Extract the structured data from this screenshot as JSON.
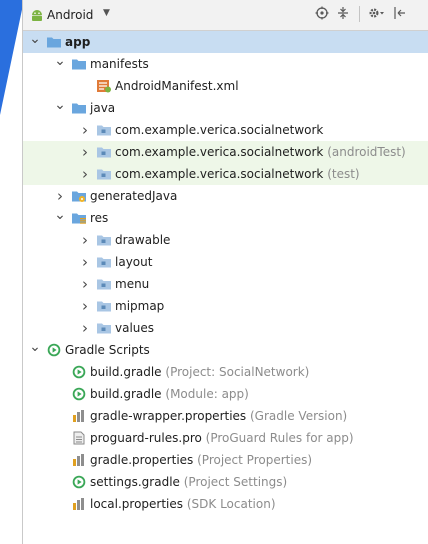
{
  "toolbar": {
    "view_label": "Android",
    "caret": "▼",
    "icons": [
      "target-icon",
      "collapse-icon",
      "gear-icon",
      "hide-icon"
    ]
  },
  "colors": {
    "selection": "#c8ddf2",
    "test_row": "#eef7e8",
    "folder_blue": "#6aa6de",
    "gradle_green": "#3aa757",
    "note_gray": "#8c8c8c",
    "deco_blue": "#2a6fde"
  },
  "tree": [
    {
      "id": "app",
      "depth": 0,
      "arrow": "expanded",
      "icon": "folder",
      "label": "app",
      "bold": true,
      "selected": true
    },
    {
      "id": "manifests",
      "depth": 1,
      "arrow": "expanded",
      "icon": "folder",
      "label": "manifests"
    },
    {
      "id": "androidmanifest",
      "depth": 2,
      "arrow": "none",
      "icon": "manifest",
      "label": "AndroidManifest.xml"
    },
    {
      "id": "java",
      "depth": 1,
      "arrow": "expanded",
      "icon": "folder",
      "label": "java"
    },
    {
      "id": "pkg-main",
      "depth": 2,
      "arrow": "collapsed",
      "icon": "package",
      "label": "com.example.verica.socialnetwork"
    },
    {
      "id": "pkg-androidtest",
      "depth": 2,
      "arrow": "collapsed",
      "icon": "package",
      "label": "com.example.verica.socialnetwork",
      "note": "(androidTest)",
      "test": true
    },
    {
      "id": "pkg-test",
      "depth": 2,
      "arrow": "collapsed",
      "icon": "package",
      "label": "com.example.verica.socialnetwork",
      "note": "(test)",
      "test": true
    },
    {
      "id": "generatedjava",
      "depth": 1,
      "arrow": "collapsed",
      "icon": "folder-generated",
      "label": "generatedJava"
    },
    {
      "id": "res",
      "depth": 1,
      "arrow": "expanded",
      "icon": "folder-res",
      "label": "res"
    },
    {
      "id": "drawable",
      "depth": 2,
      "arrow": "collapsed",
      "icon": "package",
      "label": "drawable"
    },
    {
      "id": "layout",
      "depth": 2,
      "arrow": "collapsed",
      "icon": "package",
      "label": "layout"
    },
    {
      "id": "menu",
      "depth": 2,
      "arrow": "collapsed",
      "icon": "package",
      "label": "menu"
    },
    {
      "id": "mipmap",
      "depth": 2,
      "arrow": "collapsed",
      "icon": "package",
      "label": "mipmap"
    },
    {
      "id": "values",
      "depth": 2,
      "arrow": "collapsed",
      "icon": "package",
      "label": "values"
    },
    {
      "id": "gradle-scripts",
      "depth": 0,
      "arrow": "expanded",
      "icon": "gradle",
      "label": "Gradle Scripts"
    },
    {
      "id": "build-gradle-project",
      "depth": 1,
      "arrow": "none",
      "icon": "gradle",
      "label": "build.gradle",
      "note": "(Project: SocialNetwork)"
    },
    {
      "id": "build-gradle-module",
      "depth": 1,
      "arrow": "none",
      "icon": "gradle",
      "label": "build.gradle",
      "note": "(Module: app)"
    },
    {
      "id": "gradle-wrapper-props",
      "depth": 1,
      "arrow": "none",
      "icon": "properties",
      "label": "gradle-wrapper.properties",
      "note": "(Gradle Version)"
    },
    {
      "id": "proguard-rules",
      "depth": 1,
      "arrow": "none",
      "icon": "text-file",
      "label": "proguard-rules.pro",
      "note": "(ProGuard Rules for app)"
    },
    {
      "id": "gradle-props",
      "depth": 1,
      "arrow": "none",
      "icon": "properties",
      "label": "gradle.properties",
      "note": "(Project Properties)"
    },
    {
      "id": "settings-gradle",
      "depth": 1,
      "arrow": "none",
      "icon": "gradle",
      "label": "settings.gradle",
      "note": "(Project Settings)"
    },
    {
      "id": "local-props",
      "depth": 1,
      "arrow": "none",
      "icon": "properties",
      "label": "local.properties",
      "note": "(SDK Location)"
    }
  ]
}
